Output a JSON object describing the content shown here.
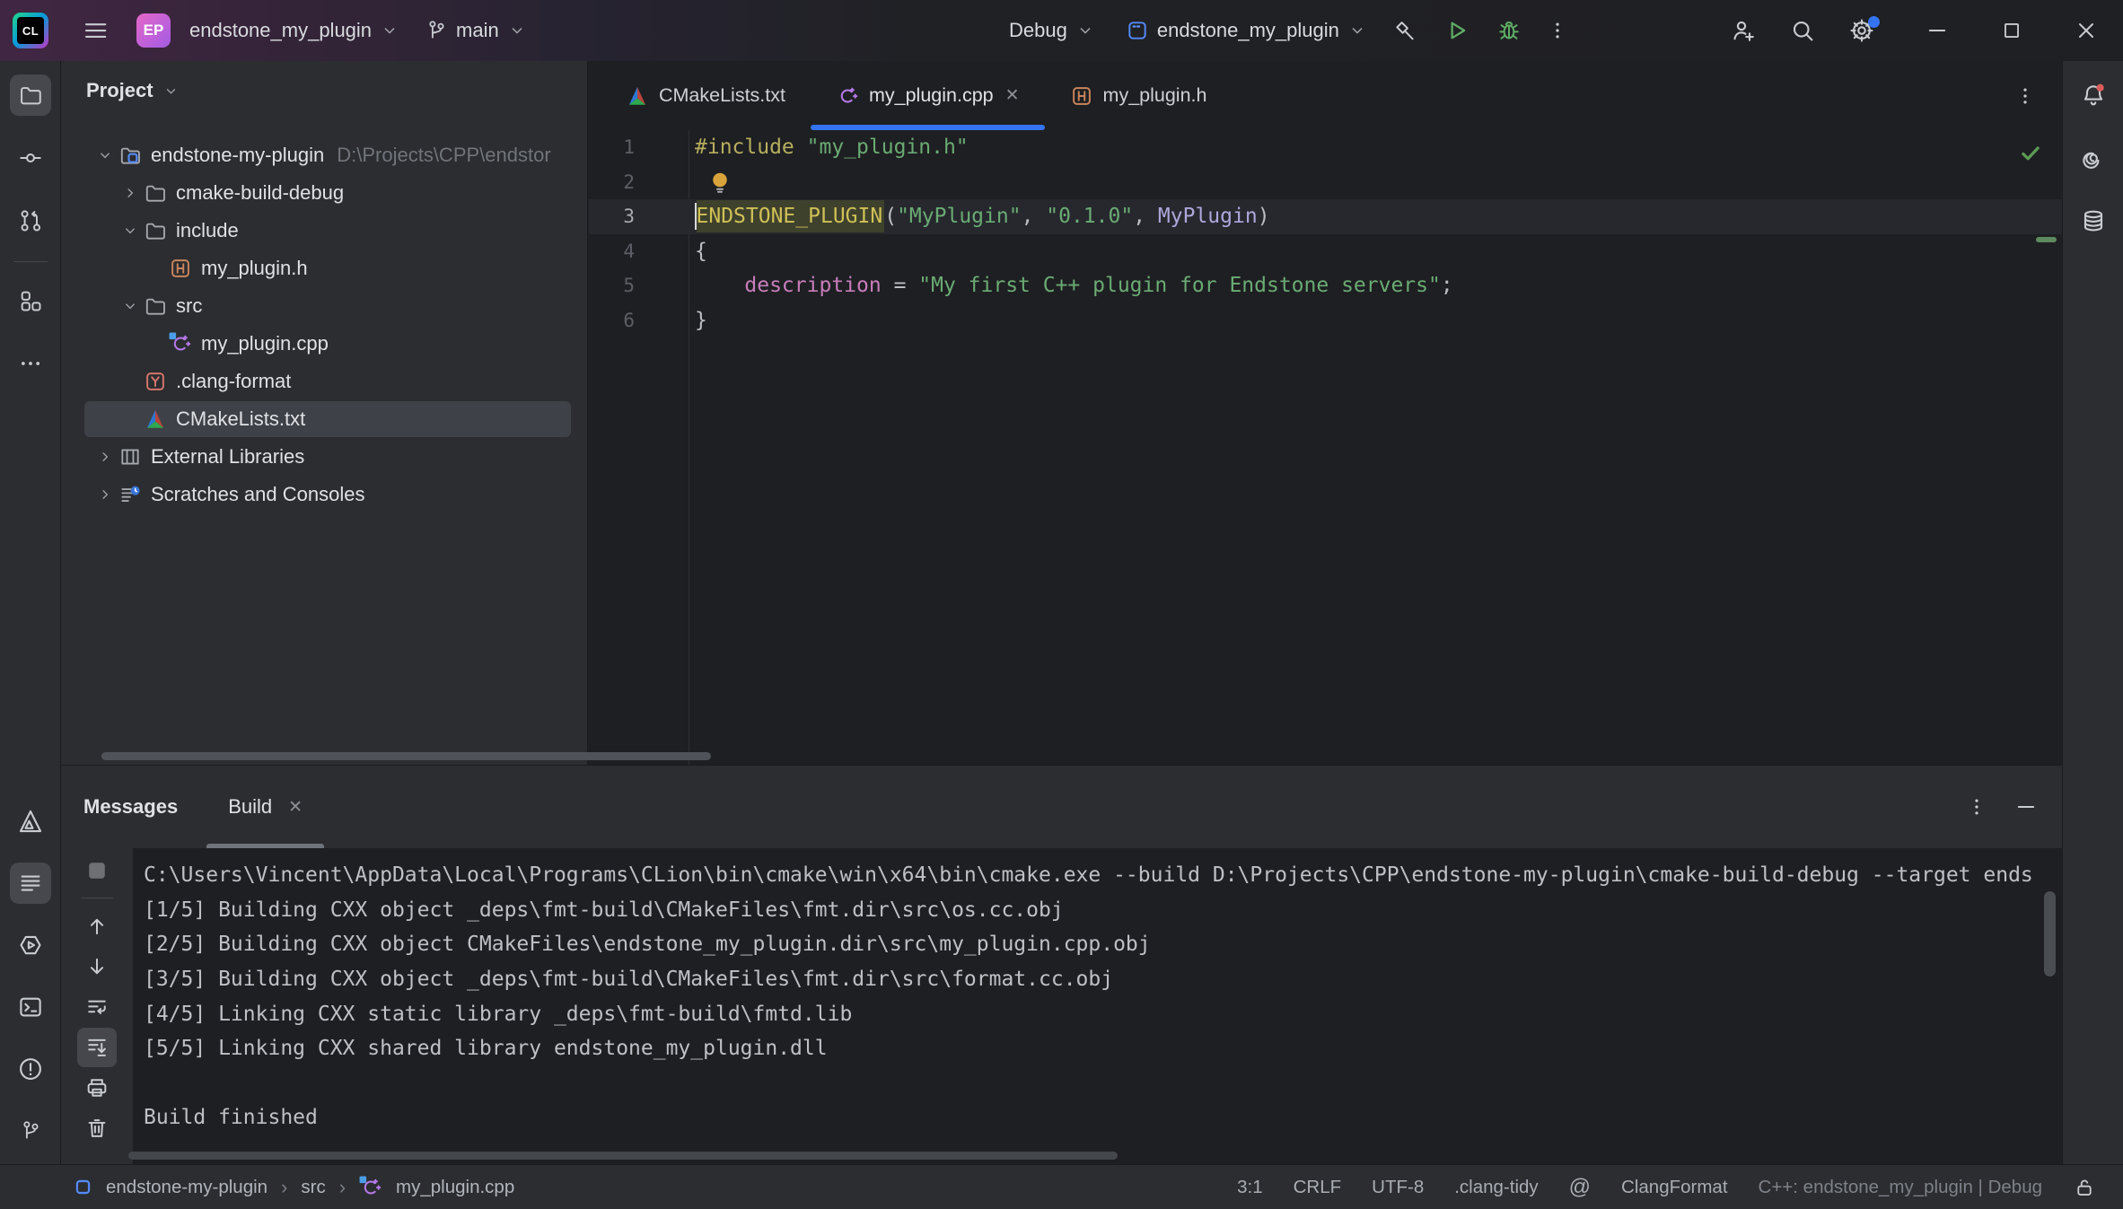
{
  "titlebar": {
    "logo_text": "CL",
    "project_badge": "EP",
    "project_name": "endstone_my_plugin",
    "branch_name": "main",
    "build_type": "Debug",
    "run_config": "endstone_my_plugin"
  },
  "tabs": [
    {
      "label": "CMakeLists.txt",
      "icon": "cmake",
      "active": false
    },
    {
      "label": "my_plugin.cpp",
      "icon": "cpp",
      "active": true,
      "closable": true
    },
    {
      "label": "my_plugin.h",
      "icon": "hfile",
      "active": false
    }
  ],
  "editor": {
    "lines": [
      {
        "num": "1",
        "tokens": [
          [
            "dir",
            "#include"
          ],
          [
            "pln",
            " "
          ],
          [
            "str",
            "\"my_plugin.h\""
          ]
        ]
      },
      {
        "num": "2",
        "bulb": true,
        "tokens": []
      },
      {
        "num": "3",
        "current": true,
        "tokens": [
          [
            "caret",
            ""
          ],
          [
            "macro",
            "ENDSTONE_PLUGIN"
          ],
          [
            "pln",
            "("
          ],
          [
            "str",
            "\"MyPlugin\""
          ],
          [
            "pln",
            ", "
          ],
          [
            "str",
            "\"0.1.0\""
          ],
          [
            "pln",
            ", "
          ],
          [
            "type",
            "MyPlugin"
          ],
          [
            "pln",
            ")"
          ]
        ]
      },
      {
        "num": "4",
        "tokens": [
          [
            "pln",
            "{"
          ]
        ]
      },
      {
        "num": "5",
        "tokens": [
          [
            "pln",
            "    "
          ],
          [
            "field",
            "description"
          ],
          [
            "pln",
            " = "
          ],
          [
            "str",
            "\"My first C++ plugin for Endstone servers\""
          ],
          [
            "pln",
            ";"
          ]
        ]
      },
      {
        "num": "6",
        "tokens": [
          [
            "pln",
            "}"
          ]
        ]
      }
    ]
  },
  "project_panel": {
    "title": "Project",
    "tree": [
      {
        "label": "endstone-my-plugin",
        "path": "D:\\Projects\\CPP\\endstor",
        "icon": "folder-project",
        "indent": 0,
        "chevron": "down"
      },
      {
        "label": "cmake-build-debug",
        "icon": "folder",
        "indent": 1,
        "chevron": "right"
      },
      {
        "label": "include",
        "icon": "folder",
        "indent": 1,
        "chevron": "down"
      },
      {
        "label": "my_plugin.h",
        "icon": "hfile",
        "indent": 2,
        "chevron": "none"
      },
      {
        "label": "src",
        "icon": "folder",
        "indent": 1,
        "chevron": "down"
      },
      {
        "label": "my_plugin.cpp",
        "icon": "cpp-mod",
        "indent": 2,
        "chevron": "none"
      },
      {
        "label": ".clang-format",
        "icon": "yaml",
        "indent": 1,
        "chevron": "none"
      },
      {
        "label": "CMakeLists.txt",
        "icon": "cmake",
        "indent": 1,
        "chevron": "none",
        "selected": true
      },
      {
        "label": "External Libraries",
        "icon": "libs",
        "indent": 0,
        "chevron": "right"
      },
      {
        "label": "Scratches and Consoles",
        "icon": "scratch",
        "indent": 0,
        "chevron": "right"
      }
    ]
  },
  "build_panel": {
    "title": "Messages",
    "tab": "Build",
    "console": [
      "C:\\Users\\Vincent\\AppData\\Local\\Programs\\CLion\\bin\\cmake\\win\\x64\\bin\\cmake.exe --build D:\\Projects\\CPP\\endstone-my-plugin\\cmake-build-debug --target ends",
      "[1/5] Building CXX object _deps\\fmt-build\\CMakeFiles\\fmt.dir\\src\\os.cc.obj",
      "[2/5] Building CXX object CMakeFiles\\endstone_my_plugin.dir\\src\\my_plugin.cpp.obj",
      "[3/5] Building CXX object _deps\\fmt-build\\CMakeFiles\\fmt.dir\\src\\format.cc.obj",
      "[4/5] Linking CXX static library _deps\\fmt-build\\fmtd.lib",
      "[5/5] Linking CXX shared library endstone_my_plugin.dll",
      "",
      "Build finished"
    ]
  },
  "statusbar": {
    "breadcrumbs": [
      "endstone-my-plugin",
      "src",
      "my_plugin.cpp"
    ],
    "caret_position": "3:1",
    "line_separator": "CRLF",
    "encoding": "UTF-8",
    "clang_tidy": ".clang-tidy",
    "clang_format": "ClangFormat",
    "cmake_profile": "C++: endstone_my_plugin | Debug"
  },
  "glyphs": {
    "close_x": "✕",
    "breadcrumb_separator": "›",
    "at_spiral": "@"
  },
  "colors": {
    "accent_blue": "#3574F0",
    "run_green": "#5FAD65",
    "notification_red": "#DB5C5C",
    "editor_bg": "#1E1F22",
    "panel_bg": "#2B2D30"
  }
}
